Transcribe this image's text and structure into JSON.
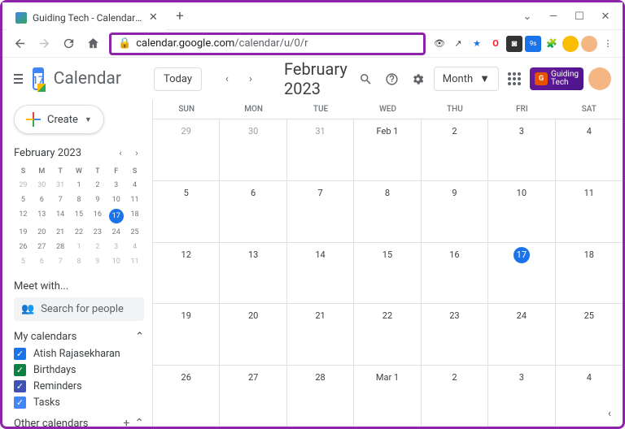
{
  "browser": {
    "tab_title": "Guiding Tech - Calendar - Febru",
    "url_domain": "calendar.google.com",
    "url_path": "/calendar/u/0/r"
  },
  "header": {
    "logo_text": "Calendar",
    "logo_day": "17",
    "today_label": "Today",
    "month_title": "February 2023",
    "view_label": "Month",
    "gt_badge": "Guiding\nTech"
  },
  "sidebar": {
    "create_label": "Create",
    "mini_month": "February 2023",
    "mini_dow": [
      "S",
      "M",
      "T",
      "W",
      "T",
      "F",
      "S"
    ],
    "mini_days": [
      [
        "29",
        "30",
        "31",
        "1",
        "2",
        "3",
        "4"
      ],
      [
        "5",
        "6",
        "7",
        "8",
        "9",
        "10",
        "11"
      ],
      [
        "12",
        "13",
        "14",
        "15",
        "16",
        "17",
        "18"
      ],
      [
        "19",
        "20",
        "21",
        "22",
        "23",
        "24",
        "25"
      ],
      [
        "26",
        "27",
        "28",
        "1",
        "2",
        "3",
        "4"
      ],
      [
        "5",
        "6",
        "7",
        "8",
        "9",
        "10",
        "11"
      ]
    ],
    "meet_label": "Meet with...",
    "search_placeholder": "Search for people",
    "mycals_label": "My calendars",
    "calendars": [
      {
        "label": "Atish Rajasekharan",
        "color": "#1a73e8"
      },
      {
        "label": "Birthdays",
        "color": "#0d8043"
      },
      {
        "label": "Reminders",
        "color": "#3f51b5"
      },
      {
        "label": "Tasks",
        "color": "#4285f4"
      }
    ],
    "othercals_label": "Other calendars"
  },
  "grid": {
    "dow": [
      "SUN",
      "MON",
      "TUE",
      "WED",
      "THU",
      "FRI",
      "SAT"
    ],
    "weeks": [
      [
        {
          "n": "29",
          "out": true
        },
        {
          "n": "30",
          "out": true
        },
        {
          "n": "31",
          "out": true
        },
        {
          "n": "Feb 1",
          "first": true
        },
        {
          "n": "2"
        },
        {
          "n": "3"
        },
        {
          "n": "4"
        }
      ],
      [
        {
          "n": "5"
        },
        {
          "n": "6"
        },
        {
          "n": "7"
        },
        {
          "n": "8"
        },
        {
          "n": "9"
        },
        {
          "n": "10"
        },
        {
          "n": "11"
        }
      ],
      [
        {
          "n": "12"
        },
        {
          "n": "13"
        },
        {
          "n": "14"
        },
        {
          "n": "15"
        },
        {
          "n": "16"
        },
        {
          "n": "17",
          "today": true
        },
        {
          "n": "18"
        }
      ],
      [
        {
          "n": "19"
        },
        {
          "n": "20"
        },
        {
          "n": "21"
        },
        {
          "n": "22"
        },
        {
          "n": "23"
        },
        {
          "n": "24"
        },
        {
          "n": "25"
        }
      ],
      [
        {
          "n": "26"
        },
        {
          "n": "27"
        },
        {
          "n": "28"
        },
        {
          "n": "Mar 1",
          "first": true
        },
        {
          "n": "2"
        },
        {
          "n": "3"
        },
        {
          "n": "4"
        }
      ]
    ]
  }
}
